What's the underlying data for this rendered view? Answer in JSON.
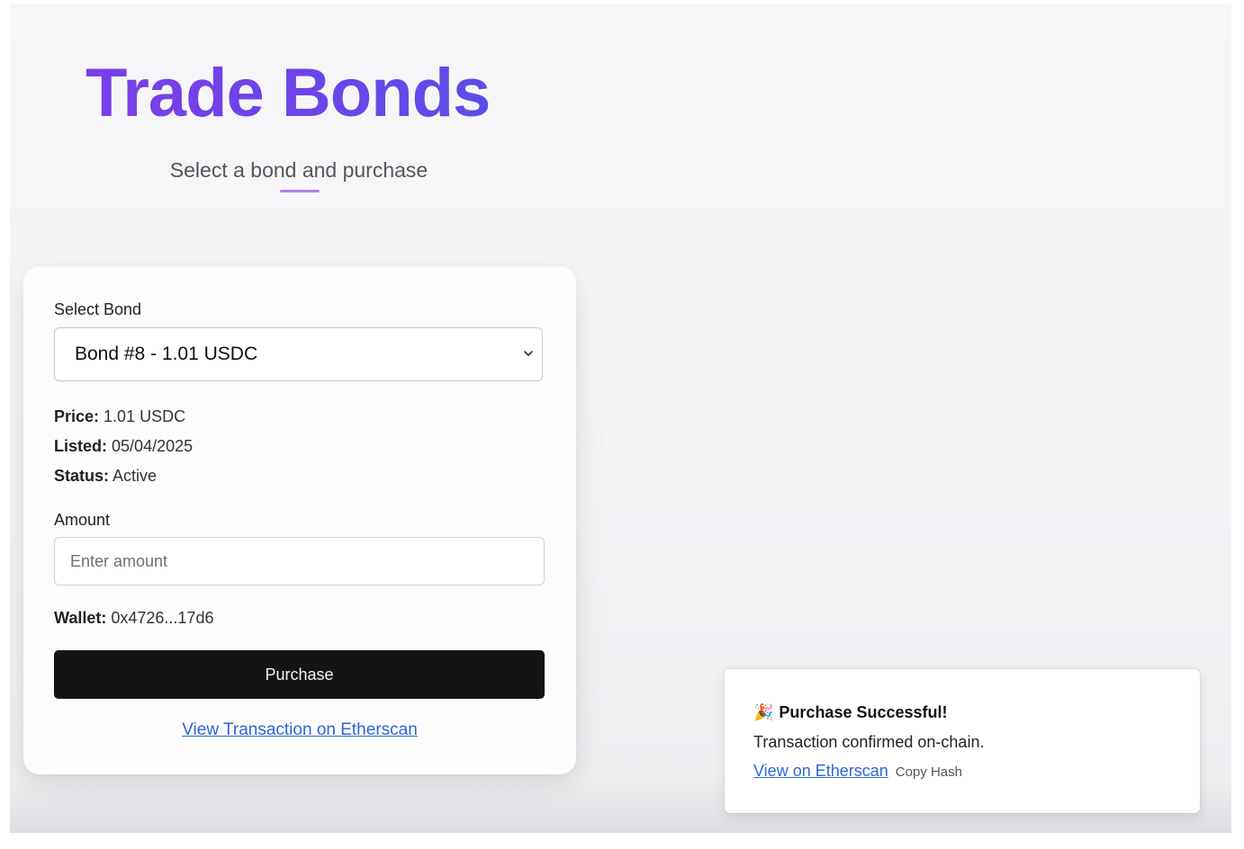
{
  "header": {
    "title": "Trade Bonds",
    "subtitle": "Select a bond and purchase"
  },
  "form": {
    "select_label": "Select Bond",
    "selected_bond": "Bond #8 - 1.01 USDC",
    "details": {
      "price_label": "Price:",
      "price_value": "1.01 USDC",
      "listed_label": "Listed:",
      "listed_value": "05/04/2025",
      "status_label": "Status:",
      "status_value": "Active"
    },
    "amount_label": "Amount",
    "amount_placeholder": "Enter amount",
    "amount_value": "",
    "wallet_label": "Wallet:",
    "wallet_value": "0x4726...17d6",
    "purchase_label": "Purchase",
    "etherscan_link_label": "View Transaction on Etherscan"
  },
  "toast": {
    "icon": "🎉",
    "title": "Purchase Successful!",
    "message": "Transaction confirmed on-chain.",
    "view_link_label": "View on Etherscan",
    "copy_hash_label": "Copy Hash"
  },
  "colors": {
    "title_gradient_start": "#7a3fe8",
    "title_gradient_end": "#5b4de6",
    "accent_underline": "#b57cf0",
    "button_bg": "#141414",
    "link": "#2f66d6"
  },
  "icons": {
    "select_chevron": "chevron-down-icon",
    "toast_icon": "party-popper-icon"
  }
}
